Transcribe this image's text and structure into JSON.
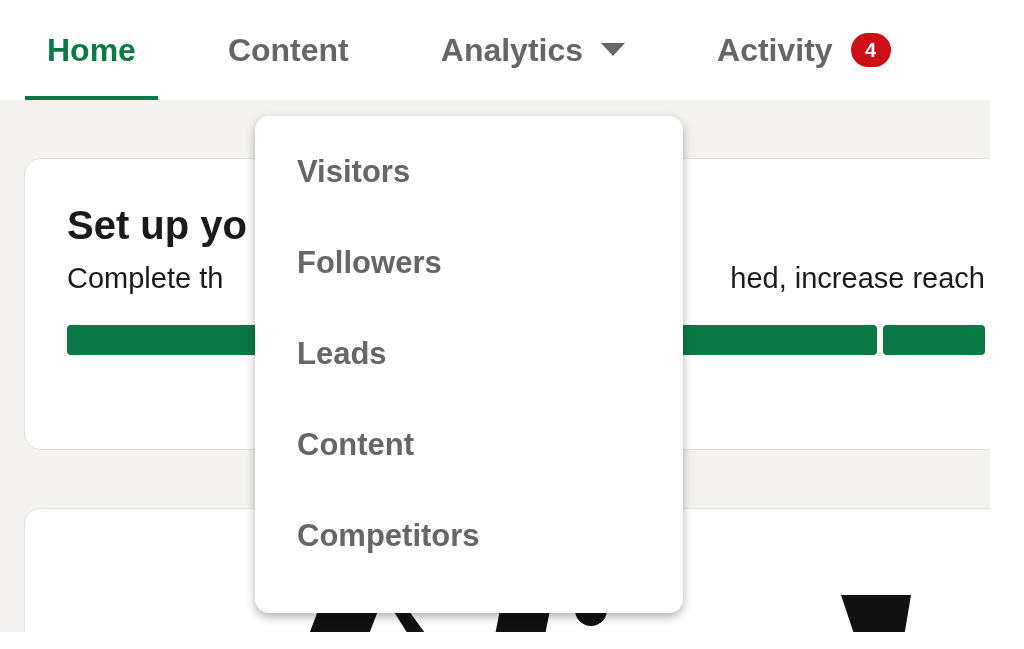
{
  "nav": {
    "tabs": [
      {
        "label": "Home",
        "selected": true
      },
      {
        "label": "Content",
        "selected": false
      },
      {
        "label": "Analytics",
        "selected": false,
        "dropdown": true
      },
      {
        "label": "Activity",
        "selected": false,
        "badge": "4"
      }
    ]
  },
  "dropdown_menu": {
    "items": [
      "Visitors",
      "Followers",
      "Leads",
      "Content",
      "Competitors"
    ]
  },
  "setup_card": {
    "title": "Set up yo",
    "description_left": "Complete th",
    "description_right": "hed, increase reach",
    "segments": [
      {
        "complete": true
      },
      {
        "complete": true
      }
    ]
  }
}
